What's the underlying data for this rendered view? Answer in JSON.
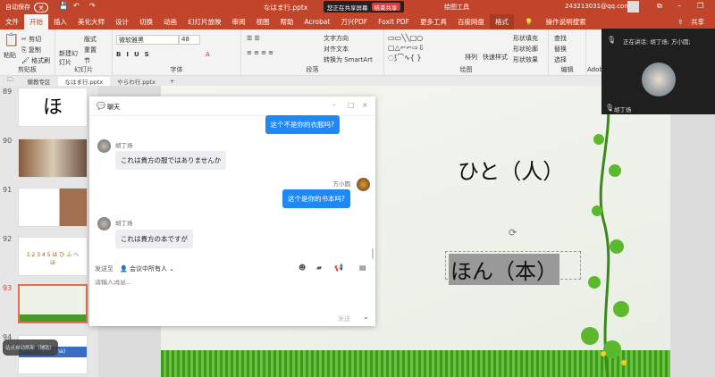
{
  "titlebar": {
    "autosave": "自动保存",
    "autosave_state": "关",
    "filename": "なはま行.pptx",
    "sharing": "您正在共享屏幕",
    "end_share": "结束共享",
    "context_tool": "绘图工具",
    "account": "243213031@qq.com"
  },
  "menu": {
    "tabs": [
      "文件",
      "开始",
      "插入",
      "美化大师",
      "设计",
      "切换",
      "动画",
      "幻灯片放映",
      "审阅",
      "视图",
      "帮助",
      "Acrobat",
      "万兴PDF",
      "Foxit PDF",
      "更多工具",
      "百度网盘",
      "格式"
    ],
    "active": "开始",
    "search": "操作说明搜索",
    "share": "共享"
  },
  "ribbon": {
    "clipboard": {
      "label": "剪贴板",
      "paste": "粘贴",
      "cut": "剪切",
      "copy": "复制",
      "format_painter": "格式刷"
    },
    "slides": {
      "label": "幻灯片",
      "new_slide": "新建幻灯片",
      "layout": "版式",
      "reset": "重置",
      "section": "节"
    },
    "font": {
      "label": "字体",
      "font_name": "微软雅黑",
      "font_size": "48"
    },
    "paragraph": {
      "label": "段落",
      "text_direction": "文字方向",
      "align_text": "对齐文本",
      "smartart": "转换为 SmartArt"
    },
    "drawing": {
      "label": "绘图",
      "arrange": "排列",
      "quick_styles": "快速样式",
      "fill": "形状填充",
      "outline": "形状轮廓",
      "effects": "形状效果"
    },
    "editing": {
      "label": "编辑",
      "find": "查找",
      "replace": "替换",
      "select": "选择"
    },
    "adobe": "Adob"
  },
  "doctabs": [
    "懒教专区",
    "なはま行.pptx",
    "やらわ行.pptx"
  ],
  "thumbs": [
    {
      "n": "89",
      "text": "ほ"
    },
    {
      "n": "90"
    },
    {
      "n": "91"
    },
    {
      "n": "92",
      "text": "1 2 3 4 5 は ひ ふ へ ほ"
    },
    {
      "n": "93",
      "selected": true
    },
    {
      "n": "94",
      "text": "主行 (ma)"
    }
  ],
  "toast": "站点自动刷新（辅助）",
  "slide": {
    "line1": "ひと（人）",
    "line2": "ほん（本）"
  },
  "chat": {
    "title": "聊天",
    "messages": [
      {
        "side": "right",
        "text": "这个不是你的衣服吗?"
      },
      {
        "side": "left",
        "sender": "胡丁炀",
        "text": "これは貴方の服ではありませんか"
      },
      {
        "side": "right",
        "sender": "方小圆",
        "text": "这个是你的书本吗?"
      },
      {
        "side": "left",
        "sender": "胡丁炀",
        "text": "これは貴方の本ですが"
      }
    ],
    "send_to": "发送至",
    "recipient": "会议中所有人",
    "placeholder": "请输入消息...",
    "send": "发送"
  },
  "video": {
    "speaking": "正在讲话: 胡丁炀; 方小圆;",
    "name": "胡丁炀"
  }
}
